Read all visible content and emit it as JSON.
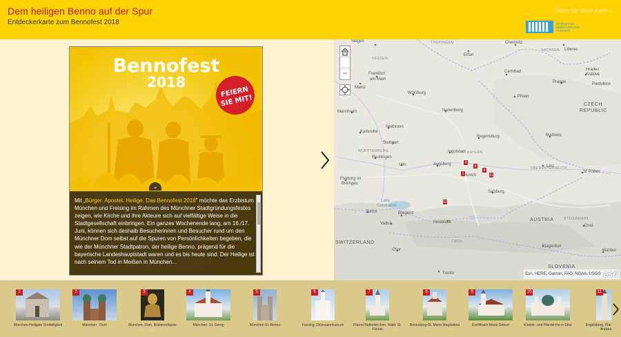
{
  "header": {
    "title": "Dem heiligen Benno auf der Spur",
    "subtitle": "Entdeckerkarte zum Bennofest 2018",
    "share_text": "Teilen Sie diese Karte",
    "logo_text": "ERZBISTUM MÜNCHEN UND FREISING"
  },
  "poster": {
    "title": "Bennofest",
    "year": "2018",
    "badge_line1": "FEIERN",
    "badge_line2": "SIE MIT!"
  },
  "story": {
    "intro_prefix": "Mit „",
    "intro_link": "Bürger. Apostel. Heilige. Das Bennofest 2018",
    "intro_suffix": "\" möchte das Erzbistum München und Freising im Rahmen des Münchner Stadtgründungsfestes zeigen, wie Kirche und ihre Akteure sich auf vielfältige Weise in die Stadtgesellschaft einbringen. Ein ganzes Wochenende lang, am 16./17. Juni, können sich deshalb Besucherinnen und Besucher rund um den Münchner Dom selbst auf die Spuren von Persönlichkeiten begeben, die wie der Münchner Stadtpatron, der heilige Benno, prägend für die bayerische Landeshauptstadt waren und es bis heute sind. Der Heilige ist nach seinem Tod in Meißen in München..."
  },
  "map": {
    "zoom_in": "+",
    "zoom_out": "−",
    "attribution": "Esri, HERE, Garmin, FAO, NOAA, USGS",
    "esri_logo": "esri",
    "labels": {
      "hessen": "HESSEN",
      "thuringen": "THÜRINGEN",
      "sachsen": "SACHSEN",
      "bayern": "BAYERN",
      "wurttemberg": "WÜRTTEMBERG",
      "oberosterreich": "OBERÖSTERREICH",
      "czech1": "CZECH",
      "czech2": "REPUBLIC",
      "austria": "AUSTRIA",
      "switzerland": "SWITZERLAND",
      "slovenia": "SLOVENIA",
      "steiermark": "STEIERMARK",
      "chemnitz": "Chemnitz",
      "liberec": "Liberec",
      "siegen": "Siegen",
      "erfurt": "Erfurt",
      "frankfurt1": "Frankfurt",
      "frankfurt2": "am Main",
      "mainz": "Mainz",
      "carlsbad": "Carlsbad",
      "prague": "Prague",
      "hradec1": "Hradec",
      "hradec2": "Králové",
      "pardubice": "Pardubice",
      "wurzburg": "Würzburg",
      "pilsen": "Pilsen",
      "mannheim": "Mannheim",
      "nuremberg": "Nuremberg",
      "heilbronn": "Heilbronn",
      "karlsruhe": "Karlsruhe",
      "regensburg": "Regensburg",
      "budweis": "Budweis",
      "stuttgart": "Stuttgart",
      "ingolstadt": "Ingolstadt",
      "reutlingen": "Reutlingen",
      "ulm": "Ulm",
      "augsburg": "Augsburg",
      "linz": "Linz",
      "stpolten": "St Pölten",
      "munich": "Munich",
      "freiburg1": "Freiburg im",
      "freiburg2": "Breisgau",
      "salzburg": "Salzburg",
      "lake": "Lake",
      "constance": "Constance",
      "zurich": "Zurich",
      "bregenz": "Bregenz",
      "vaduz": "Vaduz",
      "innsbruck": "Innsbruck",
      "graz": "Graz",
      "klagenfurt": "Klagenfurt",
      "chur": "Chur",
      "maribor": "Maribor",
      "trento": "Trento",
      "tirol": "TIROL"
    },
    "pins": [
      "1",
      "4",
      "6",
      "9",
      "11",
      "10"
    ]
  },
  "carousel": {
    "items": [
      {
        "num": "1",
        "label": "München-Heiligste Dreifaltigkeit"
      },
      {
        "num": "2",
        "label": "München - Dom"
      },
      {
        "num": "3",
        "label": "München, Dom, Büstenreliquiar"
      },
      {
        "num": "4",
        "label": "München- St. Georg"
      },
      {
        "num": "5",
        "label": "München-St. Benno"
      },
      {
        "num": "6",
        "label": "Freising, Diözesanmuseum"
      },
      {
        "num": "7",
        "label": "Pfarrei Rattenkirchen, Wald, St. Florian"
      },
      {
        "num": "8",
        "label": "Bennoberg-St. Maria Magdalena"
      },
      {
        "num": "9",
        "label": "Eschlbach-Mariä Geburt"
      },
      {
        "num": "10",
        "label": "Kloster- und Pfarrkirche in Ettal"
      },
      {
        "num": "11",
        "label": "Engelsberg, Pfar Andrea"
      }
    ]
  }
}
